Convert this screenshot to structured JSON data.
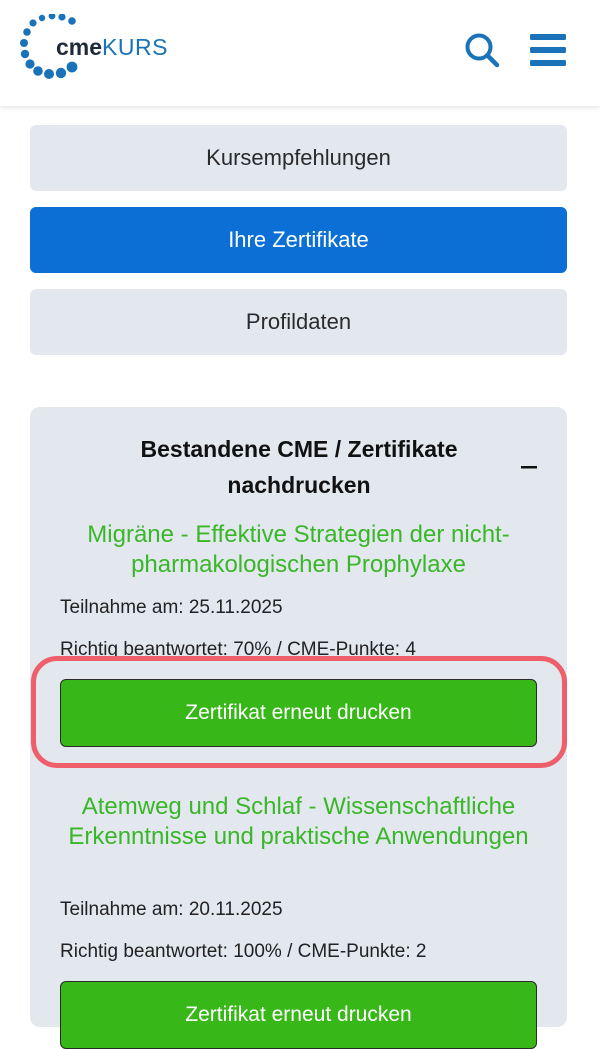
{
  "header": {
    "logo": {
      "brand_left": "cme",
      "brand_right": "KURS"
    },
    "icons": {
      "search": "search-icon",
      "menu": "hamburger-menu-icon"
    }
  },
  "nav": {
    "items": [
      {
        "label": "Kursempfehlungen",
        "active": false
      },
      {
        "label": "Ihre Zertifikate",
        "active": true
      },
      {
        "label": "Profildaten",
        "active": false
      }
    ]
  },
  "certificates": {
    "title": "Bestandene CME / Zertifikate nachdrucken",
    "collapse_symbol": "–",
    "items": [
      {
        "title": "Migräne - Effektive Strategien der nicht-pharmakologischen Prophylaxe",
        "participation": "Teilnahme am: 25.11.2025",
        "result": "Richtig beantwortet: 70% / CME-Punkte: 4",
        "button_label": "Zertifikat erneut drucken"
      },
      {
        "title": "Atemweg und Schlaf - Wissenschaftliche Erkenntnisse und praktische Anwendungen",
        "participation": "Teilnahme am: 20.11.2025",
        "result": "Richtig beantwortet: 100% / CME-Punkte: 2",
        "button_label": "Zertifikat erneut drucken"
      }
    ]
  },
  "colors": {
    "brand_blue": "#1a73b8",
    "nav_active": "#0c6fd6",
    "nav_inactive": "#e3e8ef",
    "course_title_green": "#3ab629",
    "print_button_green": "#37b718",
    "highlight_red": "#ef5f6b"
  }
}
